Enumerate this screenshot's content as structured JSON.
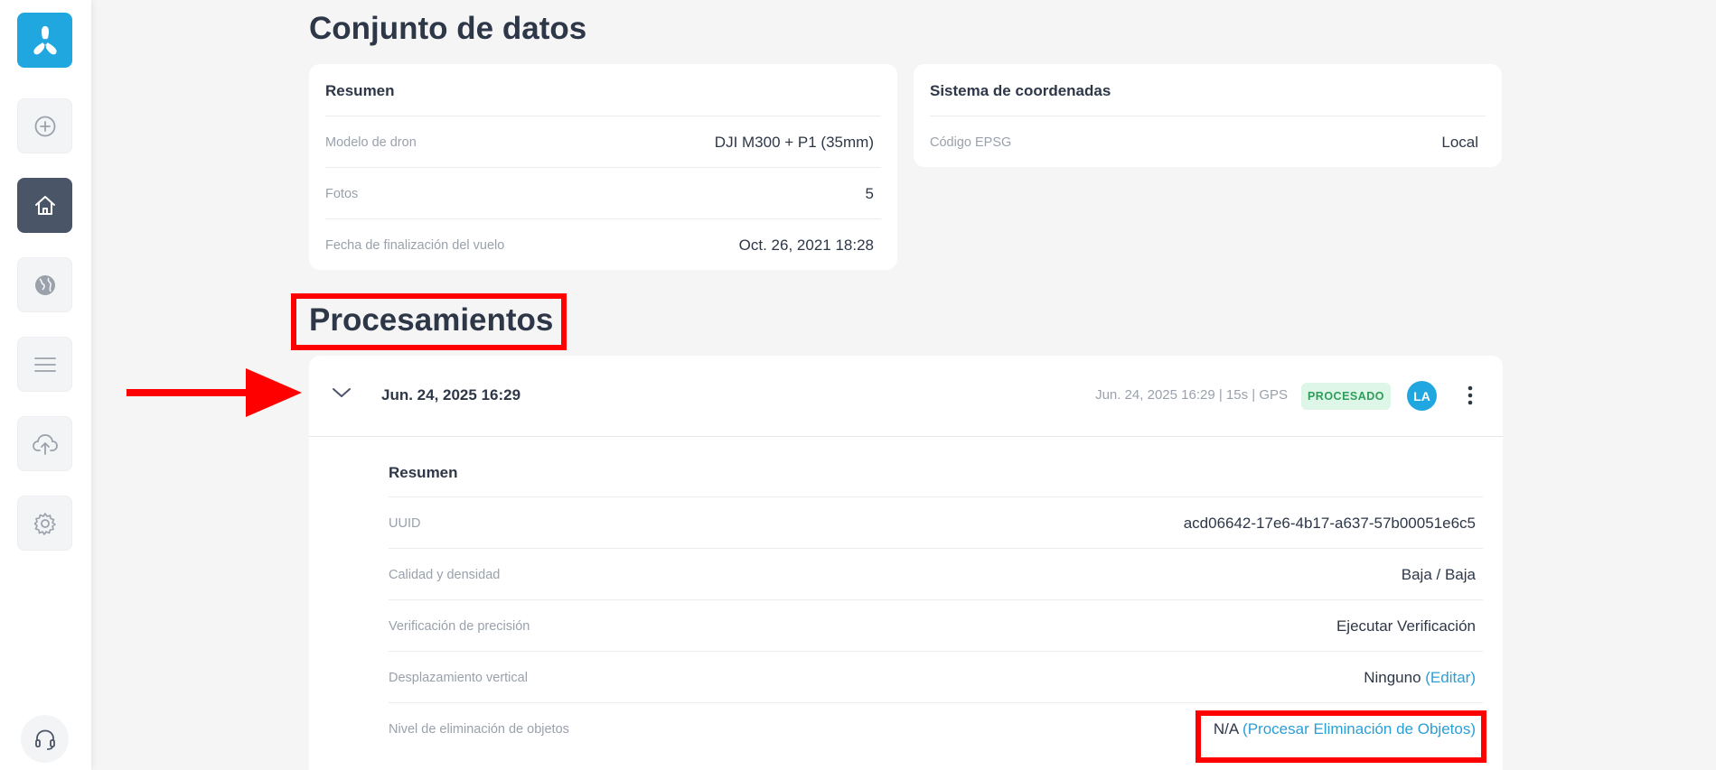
{
  "sidebar": {
    "logo_icon": "propeller-logo-icon",
    "items": [
      {
        "name": "add-icon",
        "active": false
      },
      {
        "name": "home-icon",
        "active": true
      },
      {
        "name": "globe-icon",
        "active": false
      },
      {
        "name": "menu-icon",
        "active": false
      },
      {
        "name": "upload-cloud-icon",
        "active": false
      },
      {
        "name": "gear-icon",
        "active": false
      }
    ],
    "support_icon": "headset-icon"
  },
  "dataset": {
    "heading": "Conjunto de datos",
    "summary": {
      "title": "Resumen",
      "rows": [
        {
          "label": "Modelo de dron",
          "value": "DJI M300 + P1 (35mm)"
        },
        {
          "label": "Fotos",
          "value": "5"
        },
        {
          "label": "Fecha de finalización del vuelo",
          "value": "Oct. 26, 2021 18:28"
        }
      ]
    },
    "coords": {
      "title": "Sistema de coordenadas",
      "rows": [
        {
          "label": "Código EPSG",
          "value": "Local"
        }
      ]
    }
  },
  "processing": {
    "heading": "Procesamientos",
    "item": {
      "date": "Jun. 24, 2025 16:29",
      "meta": "Jun. 24, 2025 16:29 | 15s | GPS",
      "status": "PROCESADO",
      "avatar": "LA",
      "summary_title": "Resumen",
      "uuid_label": "UUID",
      "uuid_value": "acd06642-17e6-4b17-a637-57b00051e6c5",
      "quality_label": "Calidad y densidad",
      "quality_value": "Baja / Baja",
      "precision_label": "Verificación de precisión",
      "precision_link": "Ejecutar Verificación",
      "offset_label": "Desplazamiento vertical",
      "offset_value": "Ninguno",
      "offset_link": "(Editar)",
      "removal_label": "Nivel de eliminación de objetos",
      "removal_value": "N/A",
      "removal_link": "(Procesar Eliminación de Objetos)"
    }
  },
  "colors": {
    "accent": "#21a7e0",
    "link": "#2a9fd6",
    "annotation": "#ff0000",
    "status_bg": "#ddf6e7",
    "status_text": "#2f9e5b",
    "nav_active": "#4a5568"
  }
}
